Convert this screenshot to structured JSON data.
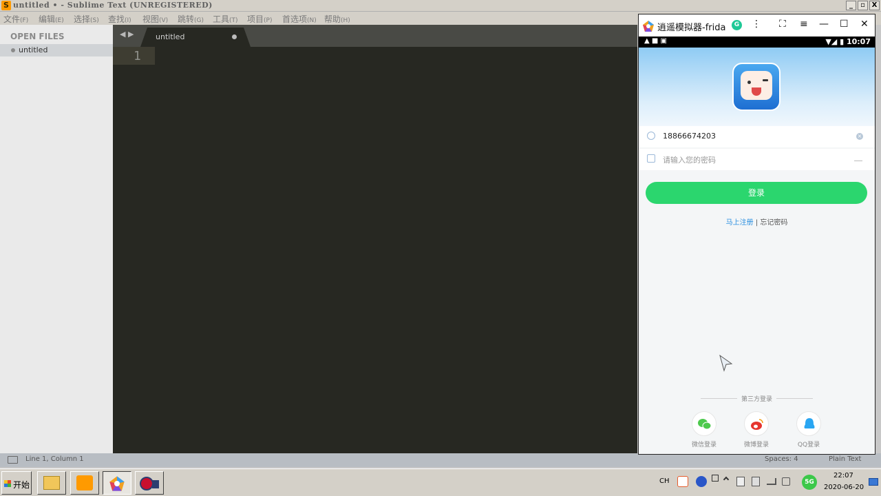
{
  "window": {
    "title": "untitled • - Sublime Text (UNREGISTERED)",
    "title_icon": "S",
    "controls": {
      "minimize": "_",
      "restore": "▫",
      "close": "X"
    }
  },
  "menu": [
    {
      "label": "文件",
      "key": "(F)"
    },
    {
      "label": "编辑",
      "key": "(E)"
    },
    {
      "label": "选择",
      "key": "(S)"
    },
    {
      "label": "查找",
      "key": "(I)"
    },
    {
      "label": "视图",
      "key": "(V)"
    },
    {
      "label": "跳转",
      "key": "(G)"
    },
    {
      "label": "工具",
      "key": "(T)"
    },
    {
      "label": "项目",
      "key": "(P)"
    },
    {
      "label": "首选项",
      "key": "(N)"
    },
    {
      "label": "帮助",
      "key": "(H)"
    }
  ],
  "sidebar": {
    "header": "OPEN FILES",
    "files": [
      "untitled"
    ]
  },
  "tabs": {
    "nav": "◀ ▶",
    "active": "untitled"
  },
  "editor": {
    "line_number": "1"
  },
  "status": {
    "position": "Line 1, Column 1",
    "spaces": "Spaces: 4",
    "syntax": "Plain Text"
  },
  "emulator": {
    "title": "逍遥模拟器-frida",
    "title_glyph": "G",
    "controls": {
      "more": "⋮",
      "fullscreen": "⛶",
      "menu": "≡",
      "minimize": "—",
      "maximize": "☐",
      "close": "✕"
    },
    "android_status": {
      "left_icons": "▲ ■ ▣",
      "right": "▼◢ ▮ 10:07"
    },
    "phone_value": "18866674203",
    "clear_glyph": "×",
    "password_placeholder": "请输入您的密码",
    "login_button": "登录",
    "register_link": "马上注册",
    "separator": " | ",
    "forgot_link": "忘记密码",
    "third_party_label": "第三方登录",
    "social": [
      {
        "label": "微信登录",
        "icon": "wechat-icon",
        "color": "#4cc94c"
      },
      {
        "label": "微博登录",
        "icon": "weibo-icon",
        "color": "#e6352f"
      },
      {
        "label": "QQ登录",
        "icon": "qq-icon",
        "color": "#2aa6f2"
      }
    ]
  },
  "taskbar": {
    "start": "开始",
    "ime": "CH",
    "clock_time": "22:07",
    "clock_date": "2020-06-20",
    "badge": "5G"
  },
  "colors": {
    "accent_green": "#2bd66e",
    "link_blue": "#2a8fe0",
    "editor_bg": "#272822"
  }
}
